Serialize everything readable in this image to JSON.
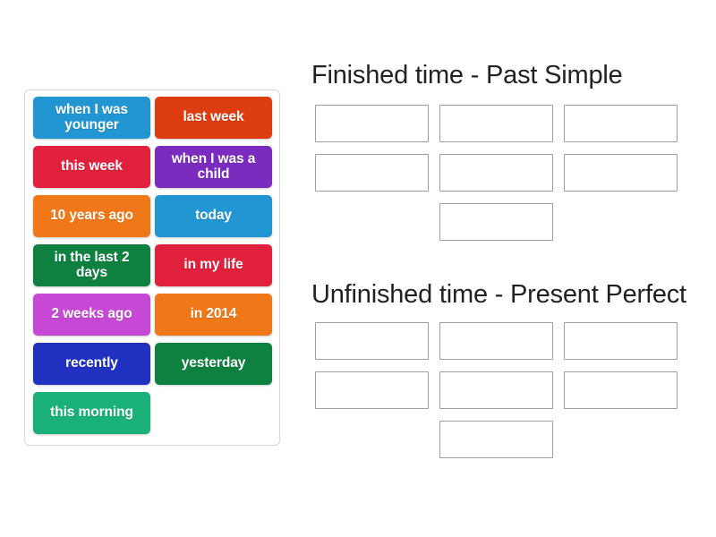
{
  "activity": {
    "type": "group-sort",
    "tile_panel": {
      "name": "word-bank",
      "tiles": [
        {
          "label": "when I was younger",
          "color": "#2196d3"
        },
        {
          "label": "last week",
          "color": "#dd3c10"
        },
        {
          "label": "this week",
          "color": "#e0203c"
        },
        {
          "label": "when I was a child",
          "color": "#7b2cbf"
        },
        {
          "label": "10 years ago",
          "color": "#f07818"
        },
        {
          "label": "today",
          "color": "#2196d3"
        },
        {
          "label": "in the last 2 days",
          "color": "#0e8040"
        },
        {
          "label": "in my life",
          "color": "#e0203c"
        },
        {
          "label": "2 weeks ago",
          "color": "#c549d4"
        },
        {
          "label": "in 2014",
          "color": "#f07818"
        },
        {
          "label": "recently",
          "color": "#2030c0"
        },
        {
          "label": "yesterday",
          "color": "#0e8040"
        },
        {
          "label": "this morning",
          "color": "#19b177"
        }
      ]
    },
    "groups": [
      {
        "heading": "Finished time - Past Simple",
        "drop_zone_count": 7,
        "drop_zones": [
          "",
          "",
          "",
          "",
          "",
          "",
          ""
        ]
      },
      {
        "heading": "Unfinished time - Present Perfect",
        "drop_zone_count": 7,
        "drop_zones": [
          "",
          "",
          "",
          "",
          "",
          "",
          ""
        ]
      }
    ],
    "colors": {
      "panel_border": "#d8d8d8",
      "drop_zone_border": "#9e9e9e",
      "heading_text": "#222222",
      "background": "#ffffff",
      "tile_text": "#ffffff"
    }
  }
}
